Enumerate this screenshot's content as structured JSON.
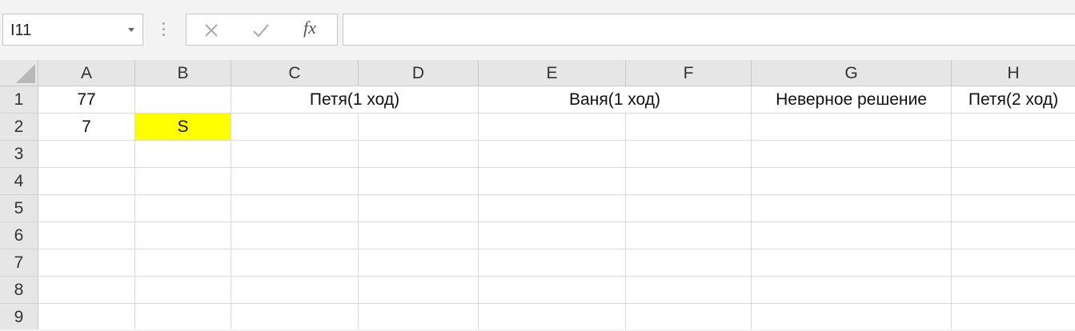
{
  "formula_bar": {
    "name_box": "I11",
    "fx_label": "fx",
    "formula_value": ""
  },
  "columns": [
    "A",
    "B",
    "C",
    "D",
    "E",
    "F",
    "G",
    "H"
  ],
  "rows": [
    "1",
    "2",
    "3",
    "4",
    "5",
    "6",
    "7",
    "8",
    "9"
  ],
  "cells": {
    "A1": "77",
    "A2": "7",
    "B2": "S",
    "CD1": "Петя(1 ход)",
    "EF1": "Ваня(1 ход)",
    "G1": "Неверное решение",
    "H1": "Петя(2 ход)"
  },
  "colors": {
    "highlight": "#ffff00"
  }
}
